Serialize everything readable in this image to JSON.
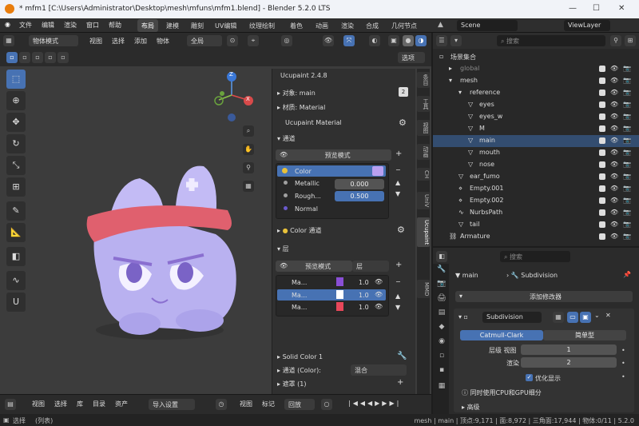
{
  "window": {
    "title": "* mfm1 [C:\\Users\\Administrator\\Desktop\\mesh\\mfuns\\mfm1.blend] - Blender 5.2.0 LTS"
  },
  "menu": [
    "文件",
    "编辑",
    "渲染",
    "窗口",
    "帮助"
  ],
  "workspaces": [
    "布局",
    "建模",
    "雕刻",
    "UV编辑",
    "纹理绘制",
    "着色",
    "动画",
    "渲染",
    "合成",
    "几何节点"
  ],
  "scene": "Scene",
  "view_layer": "ViewLayer",
  "viewport_header": {
    "mode": "物体模式",
    "menus": [
      "视图",
      "选择",
      "添加",
      "物体"
    ],
    "orientation": "全局",
    "options": "选项"
  },
  "npanel": {
    "addon_title": "Ucupaint 2.4.8",
    "object_label": "对象: main",
    "material_label": "材质: Material",
    "ucupaint_material": "Ucupaint Material",
    "channels_header": "通道",
    "preview_mode": "预览模式",
    "channels": [
      {
        "name": "Color",
        "value": "",
        "dot": "#e8c13a"
      },
      {
        "name": "Metallic",
        "value": "0.000",
        "dot": "#a0a0a0"
      },
      {
        "name": "Rough...",
        "value": "0.500",
        "dot": "#a0a0a0"
      },
      {
        "name": "Normal",
        "value": "",
        "dot": "#6a5acd"
      }
    ],
    "color_channel": "Color 通道",
    "layers_header": "层",
    "layer_preview": "预览模式",
    "layer_dropdown": "层",
    "layers": [
      {
        "name": "Ma...",
        "opacity": "1.0",
        "color": "#8a4fd6"
      },
      {
        "name": "Ma...",
        "opacity": "1.0",
        "color": "#ffffff"
      },
      {
        "name": "Ma...",
        "opacity": "1.0",
        "color": "#e8475a"
      }
    ],
    "solid_color": "Solid Color 1",
    "channel_color_label": "通道 (Color):",
    "blend_mode": "混合",
    "mask_label": "遮罩 (1)",
    "tabs": [
      "条目",
      "工具",
      "视图",
      "动画",
      "CH",
      "UniV",
      "Ucupaint",
      "MMD"
    ]
  },
  "gizmo": {
    "z": "Z",
    "x": "X"
  },
  "outliner": {
    "search_placeholder": "搜索",
    "rows": [
      {
        "name": "场景集合",
        "depth": 0
      },
      {
        "name": "global",
        "depth": 1
      },
      {
        "name": "mesh",
        "depth": 1
      },
      {
        "name": "reference",
        "depth": 2
      },
      {
        "name": "eyes",
        "depth": 3
      },
      {
        "name": "eyes_w",
        "depth": 3
      },
      {
        "name": "M",
        "depth": 3
      },
      {
        "name": "main",
        "depth": 3
      },
      {
        "name": "mouth",
        "depth": 3
      },
      {
        "name": "nose",
        "depth": 3
      },
      {
        "name": "ear_fumo",
        "depth": 2
      },
      {
        "name": "Empty.001",
        "depth": 2
      },
      {
        "name": "Empty.002",
        "depth": 2
      },
      {
        "name": "NurbsPath",
        "depth": 2
      },
      {
        "name": "tail",
        "depth": 2
      },
      {
        "name": "Armature",
        "depth": 1
      }
    ],
    "ref_badge": "2"
  },
  "properties": {
    "search_placeholder": "搜索",
    "breadcrumb_object": "main",
    "breadcrumb_modifier": "Subdivision",
    "add_modifier": "添加修改器",
    "modifier_name": "Subdivision",
    "type_a": "Catmull-Clark",
    "type_b": "简单型",
    "levels_label": "层级 视图",
    "levels_value": "1",
    "render_label": "渲染",
    "render_value": "2",
    "optimal_display": "优化显示",
    "gpu_note": "同时使用CPU和GPU细分",
    "advanced": "高级"
  },
  "timeline": {
    "menus": [
      "视图",
      "选择",
      "库",
      "目录",
      "资产"
    ],
    "import_settings": "导入设置",
    "menus2": [
      "视图",
      "标记"
    ],
    "playback": "回放"
  },
  "status": {
    "left": "选择",
    "left2": "(列表)",
    "right": "mesh | main | 顶点:9,171 | 面:8,972 | 三角面:17,944 | 物体:0/11 | 5.2.0"
  },
  "colors": {
    "accent": "#4772b3",
    "character": "#b9b1f0",
    "headband": "#e0606e"
  }
}
